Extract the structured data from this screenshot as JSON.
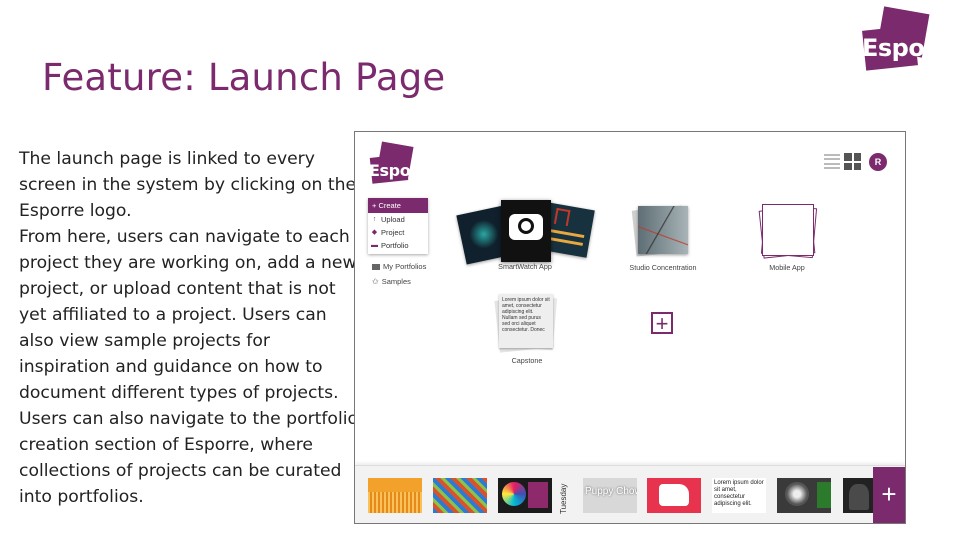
{
  "slide": {
    "title": "Feature: Launch Page",
    "logo_text": "Esporre",
    "paragraphs": [
      "The launch page is linked to every screen in the system by clicking on the Esporre logo.",
      "From here, users can navigate to each project they are working on, add a new project, or upload content that is not yet affiliated to a project. Users can also view sample projects for inspiration and guidance on how to document different types of projects.",
      "Users can also navigate to the portfolio creation section of Esporre, where collections of projects can be curated into portfolios."
    ]
  },
  "app": {
    "logo_text": "Esporre",
    "avatar_initial": "R",
    "menu": {
      "create_label": "+ Create",
      "items": [
        "Upload",
        "Project",
        "Portfolio"
      ],
      "icons": [
        "upload-icon",
        "project-icon",
        "portfolio-icon"
      ]
    },
    "sidebar": {
      "my_portfolios": "My Portfolios",
      "samples": "Samples"
    },
    "projects": [
      {
        "label": "SmartWatch App"
      },
      {
        "label": "Studio Concentration"
      },
      {
        "label": "Mobile App"
      },
      {
        "label": "Capstone"
      }
    ],
    "capstone_card_text": "Lorem ipsum dolor sit amet, consectetur adipiscing elit. Nullam sed purus sed orci aliquet consectetur. Donec",
    "strip": {
      "tuesday_label": "Tuesday",
      "puppy_label": "Puppy Chow",
      "lorem_text": "Lorem ipsum dolor sit amet, consectetur adipiscing elit.",
      "add_label": "+"
    },
    "colors": {
      "brand": "#7b2a6e",
      "text": "#222222"
    }
  }
}
